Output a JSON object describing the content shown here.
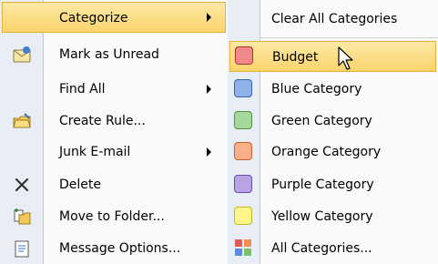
{
  "main_menu": {
    "categorize": "Categorize",
    "mark_unread": "Mark as Unread",
    "find_all": "Find All",
    "create_rule": "Create Rule...",
    "junk_email": "Junk E-mail",
    "delete": "Delete",
    "move_to_folder": "Move to Folder...",
    "message_options": "Message Options..."
  },
  "submenu": {
    "clear_all": "Clear All Categories",
    "items": [
      {
        "label": "Budget",
        "color": "#e05a5a"
      },
      {
        "label": "Blue Category",
        "color": "#5b8bdc"
      },
      {
        "label": "Green Category",
        "color": "#7ac16b"
      },
      {
        "label": "Orange Category",
        "color": "#f28c52"
      },
      {
        "label": "Purple Category",
        "color": "#9a7bd0"
      },
      {
        "label": "Yellow Category",
        "color": "#f6ec4a"
      }
    ],
    "all_categories": "All Categories..."
  },
  "colors": {
    "highlight": "#fbd46c",
    "gutter": "#e9eef6"
  },
  "icons": {
    "mark_unread": "envelope-icon",
    "create_rule": "rule-icon",
    "delete": "delete-x-icon",
    "move_to_folder": "move-folder-icon",
    "message_options": "options-icon",
    "all_categories": "all-categories-icon"
  }
}
